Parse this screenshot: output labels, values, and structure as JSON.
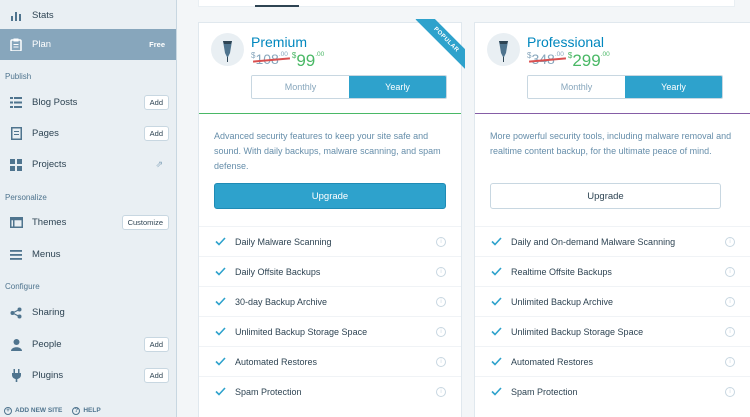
{
  "sidebar": {
    "items": [
      {
        "label": "Stats",
        "icon": "bar-chart-icon"
      },
      {
        "label": "Plan",
        "tag": "Free",
        "icon": "clipboard-icon"
      },
      {
        "label": "Blog Posts",
        "button": "Add",
        "icon": "posts-icon"
      },
      {
        "label": "Pages",
        "button": "Add",
        "icon": "page-icon"
      },
      {
        "label": "Projects",
        "icon": "portfolio-icon"
      },
      {
        "label": "Themes",
        "button": "Customize",
        "icon": "themes-icon"
      },
      {
        "label": "Menus",
        "icon": "menu-icon"
      },
      {
        "label": "Sharing",
        "icon": "share-icon"
      },
      {
        "label": "People",
        "button": "Add",
        "icon": "person-icon"
      },
      {
        "label": "Plugins",
        "button": "Add",
        "icon": "plug-icon"
      }
    ],
    "sections": {
      "publish": "Publish",
      "personalize": "Personalize",
      "configure": "Configure"
    },
    "footer": {
      "add_new_site": "ADD NEW SITE",
      "help": "HELP"
    }
  },
  "plans": [
    {
      "name": "Premium",
      "old_currency": "$",
      "old_price": "108",
      "old_decimals": ".00",
      "new_currency": "$",
      "new_price": "99",
      "new_decimals": ".00",
      "toggle_monthly": "Monthly",
      "toggle_yearly": "Yearly",
      "badge": "POPULAR",
      "description": "Advanced security features to keep your site safe and sound. With daily backups, malware scanning, and spam defense.",
      "cta": "Upgrade",
      "features": [
        "Daily Malware Scanning",
        "Daily Offsite Backups",
        "30-day Backup Archive",
        "Unlimited Backup Storage Space",
        "Automated Restores",
        "Spam Protection"
      ]
    },
    {
      "name": "Professional",
      "old_currency": "$",
      "old_price": "348",
      "old_decimals": ".00",
      "new_currency": "$",
      "new_price": "299",
      "new_decimals": ".00",
      "toggle_monthly": "Monthly",
      "toggle_yearly": "Yearly",
      "description": "More powerful security tools, including malware removal and realtime content backup, for the ultimate peace of mind.",
      "cta": "Upgrade",
      "features": [
        "Daily and On-demand Malware Scanning",
        "Realtime Offsite Backups",
        "Unlimited Backup Archive",
        "Unlimited Backup Storage Space",
        "Automated Restores",
        "Spam Protection"
      ]
    }
  ],
  "colors": {
    "accent": "#2ea2cc",
    "sidebar_active": "#87a6bc",
    "price_new": "#4ab866",
    "strike": "#d94f4f",
    "premium_rule": "#4ab866",
    "professional_rule": "#855da6"
  }
}
